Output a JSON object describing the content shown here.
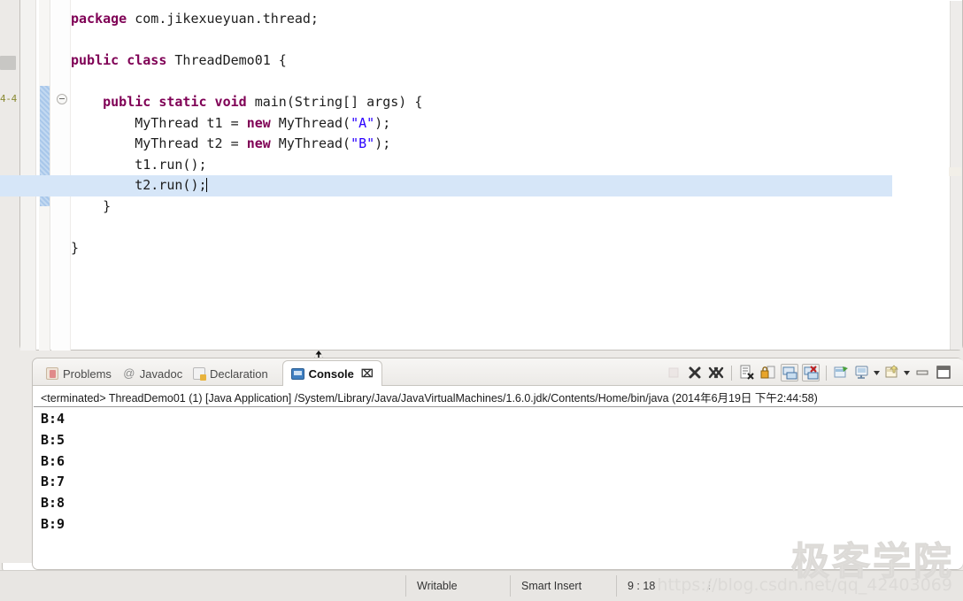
{
  "editor": {
    "quick_diff_label": "4-4",
    "caret_position": "9 : 18",
    "code_lines": [
      {
        "id": "l1",
        "indent": 0,
        "parts": [
          {
            "t": "kw",
            "s": "package"
          },
          {
            "t": "n",
            "s": " com.jikexueyuan.thread;"
          }
        ]
      },
      {
        "id": "l2",
        "indent": 0,
        "parts": []
      },
      {
        "id": "l3",
        "indent": 0,
        "parts": [
          {
            "t": "kw",
            "s": "public class"
          },
          {
            "t": "n",
            "s": " ThreadDemo01 {"
          }
        ]
      },
      {
        "id": "l4",
        "indent": 0,
        "parts": []
      },
      {
        "id": "l5",
        "indent": 1,
        "parts": [
          {
            "t": "kw",
            "s": "public static void"
          },
          {
            "t": "n",
            "s": " main(String[] args) {"
          }
        ]
      },
      {
        "id": "l6",
        "indent": 2,
        "parts": [
          {
            "t": "n",
            "s": "MyThread t1 = "
          },
          {
            "t": "kw",
            "s": "new"
          },
          {
            "t": "n",
            "s": " MyThread("
          },
          {
            "t": "str",
            "s": "\"A\""
          },
          {
            "t": "n",
            "s": ");"
          }
        ]
      },
      {
        "id": "l7",
        "indent": 2,
        "parts": [
          {
            "t": "n",
            "s": "MyThread t2 = "
          },
          {
            "t": "kw",
            "s": "new"
          },
          {
            "t": "n",
            "s": " MyThread("
          },
          {
            "t": "str",
            "s": "\"B\""
          },
          {
            "t": "n",
            "s": ");"
          }
        ]
      },
      {
        "id": "l8",
        "indent": 2,
        "parts": [
          {
            "t": "n",
            "s": "t1.run();"
          }
        ]
      },
      {
        "id": "l9",
        "indent": 2,
        "current": true,
        "caret": true,
        "parts": [
          {
            "t": "n",
            "s": "t2.run();"
          }
        ]
      },
      {
        "id": "l10",
        "indent": 1,
        "parts": [
          {
            "t": "n",
            "s": "}"
          }
        ]
      },
      {
        "id": "l11",
        "indent": 0,
        "parts": []
      },
      {
        "id": "l12",
        "indent": 0,
        "parts": [
          {
            "t": "n",
            "s": "}"
          }
        ]
      }
    ],
    "colors": {
      "keyword": "#7f0055",
      "string": "#2a00ff",
      "plain": "#1d1d1d",
      "current_line_highlight": "#d6e6f8",
      "change_bar": "#a8c7ea"
    }
  },
  "console_view": {
    "tabs": [
      {
        "label": "Problems",
        "icon": "problems-icon",
        "active": false
      },
      {
        "label": "Javadoc",
        "icon": "javadoc-at-icon",
        "active": false
      },
      {
        "label": "Declaration",
        "icon": "declaration-icon",
        "active": false
      },
      {
        "label": "Console",
        "icon": "console-icon",
        "active": true,
        "close_glyph": "⌧"
      }
    ],
    "toolbar": [
      {
        "name": "terminate-button",
        "disabled": true
      },
      {
        "name": "remove-launch-button",
        "disabled": false
      },
      {
        "name": "remove-all-terminated-button",
        "disabled": false
      },
      {
        "name": "separator-1",
        "separator": true
      },
      {
        "name": "clear-console-button",
        "disabled": false
      },
      {
        "name": "scroll-lock-button",
        "disabled": false
      },
      {
        "name": "show-console-on-output-button",
        "framed": true
      },
      {
        "name": "show-console-on-error-button",
        "framed": true
      },
      {
        "name": "separator-2",
        "separator": true
      },
      {
        "name": "open-console-button",
        "disabled": false
      },
      {
        "name": "display-selected-console-button",
        "dropdown": true
      },
      {
        "name": "new-console-view-button",
        "dropdown": true
      },
      {
        "name": "minimize-button",
        "disabled": false
      },
      {
        "name": "maximize-button",
        "disabled": false
      }
    ],
    "terminated_line": "<terminated> ThreadDemo01 (1) [Java Application] /System/Library/Java/JavaVirtualMachines/1.6.0.jdk/Contents/Home/bin/java (2014年6月19日 下午2:44:58)",
    "output": [
      "B:4",
      "B:5",
      "B:6",
      "B:7",
      "B:8",
      "B:9"
    ]
  },
  "statusbar": {
    "writable": "Writable",
    "insert_mode": "Smart Insert",
    "position": "9 : 18",
    "dots": "⋮"
  },
  "watermark": {
    "logo": "极客学院",
    "url": "https://blog.csdn.net/qq_42403069"
  }
}
